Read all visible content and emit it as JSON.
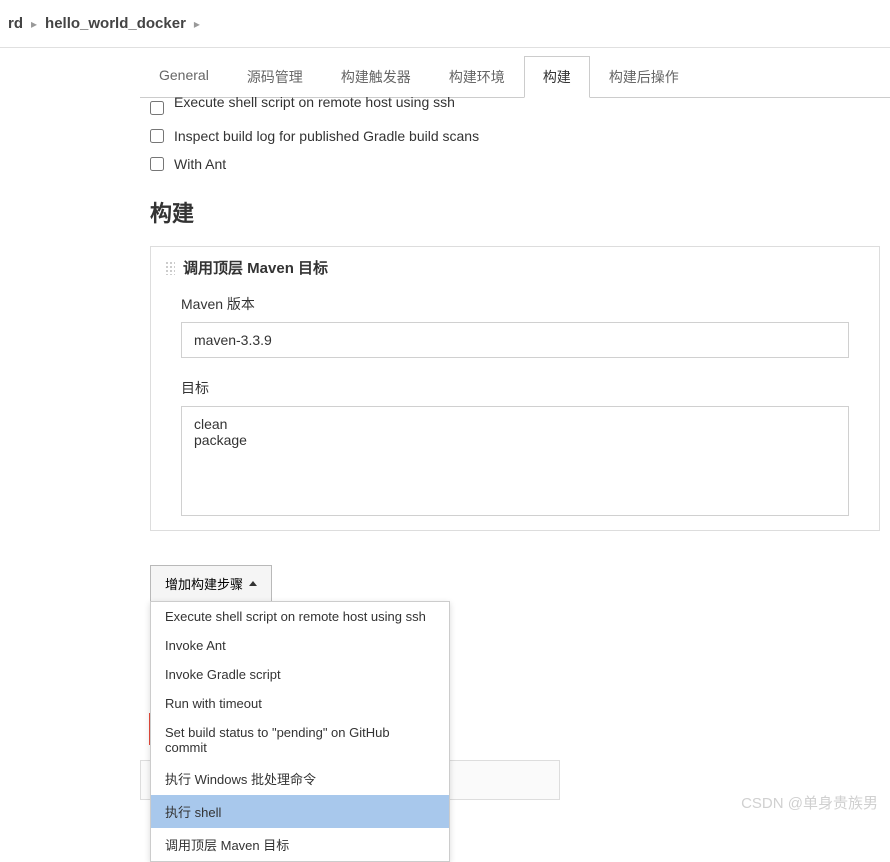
{
  "breadcrumb": {
    "item1": "rd",
    "item2": "hello_world_docker"
  },
  "tabs": {
    "general": "General",
    "source": "源码管理",
    "triggers": "构建触发器",
    "environment": "构建环境",
    "build": "构建",
    "post": "构建后操作"
  },
  "checkboxes": {
    "ssh_scroll": "Execute shell script on remote host using ssh",
    "gradle_scan": "Inspect build log for published Gradle build scans",
    "with_ant": "With Ant"
  },
  "section": {
    "build_title": "构建"
  },
  "maven_card": {
    "title": "调用顶层 Maven 目标",
    "version_label": "Maven 版本",
    "version_value": "maven-3.3.9",
    "goals_label": "目标",
    "goals_value": "clean\npackage"
  },
  "add_step": {
    "button_label": "增加构建步骤"
  },
  "dropdown": {
    "items": [
      "Execute shell script on remote host using ssh",
      "Invoke Ant",
      "Invoke Gradle script",
      "Run with timeout",
      "Set build status to \"pending\" on GitHub commit",
      "执行 Windows 批处理命令",
      "执行 shell",
      "调用顶层 Maven 目标"
    ]
  },
  "watermark": "CSDN @单身贵族男"
}
